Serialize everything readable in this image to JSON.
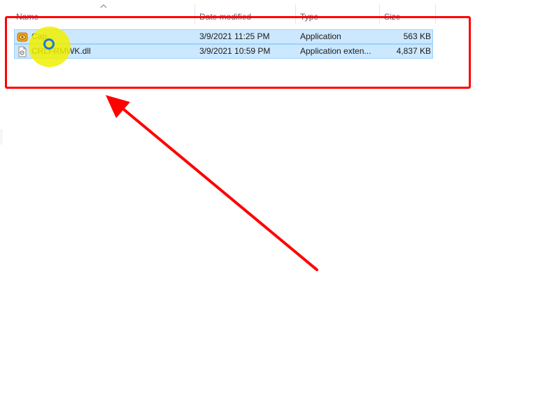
{
  "columns": {
    "name": "Name",
    "date_modified": "Date modified",
    "type": "Type",
    "size": "Size"
  },
  "files": [
    {
      "name": "Cap",
      "date_modified": "3/9/2021 11:25 PM",
      "type": "Application",
      "size": "563 KB",
      "icon": "application-icon"
    },
    {
      "name": "CRLFRMWK.dll",
      "date_modified": "3/9/2021 10:59 PM",
      "type": "Application exten...",
      "size": "4,837 KB",
      "icon": "dll-file-icon"
    }
  ],
  "annotation": {
    "box_color": "#ff0000",
    "arrow_color": "#ff0000",
    "cursor_highlight_color": "#f0f000"
  },
  "colors": {
    "selection_bg": "#cce8ff",
    "selection_border": "#99d1ff",
    "header_text": "#4c607a"
  }
}
